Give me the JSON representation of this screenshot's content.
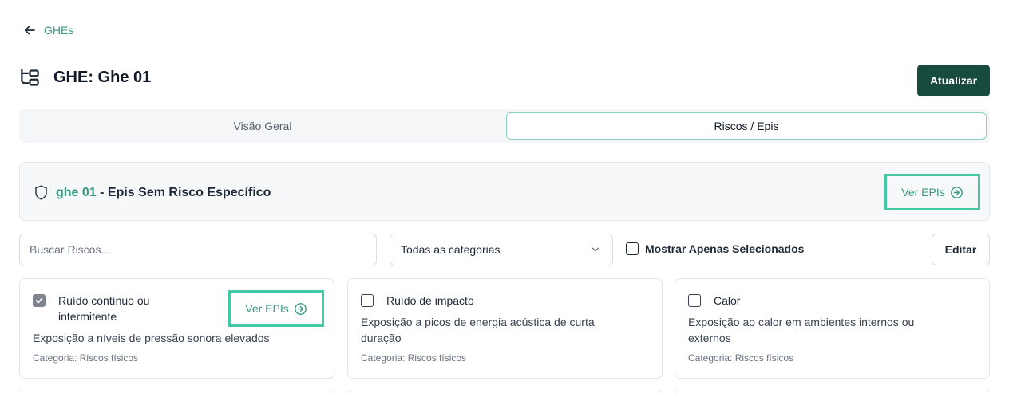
{
  "nav": {
    "back_label": "GHEs"
  },
  "header": {
    "title": "GHE: Ghe 01",
    "update_button": "Atualizar"
  },
  "tabs": [
    {
      "label": "Visão Geral",
      "active": false
    },
    {
      "label": "Riscos / Epis",
      "active": true
    }
  ],
  "panel": {
    "ghe_name": "ghe 01",
    "text": " - Epis Sem Risco Específico",
    "button_label": "Ver EPIs"
  },
  "filters": {
    "search_placeholder": "Buscar Riscos...",
    "category_selected": "Todas as categorias",
    "only_selected_label": "Mostrar Apenas Selecionados",
    "only_selected_checked": false,
    "edit_button": "Editar"
  },
  "risks": [
    {
      "name_line1": "Ruído contínuo ou",
      "name_line2": "intermitente",
      "checked": true,
      "description": "Exposição a níveis de pressão sonora elevados",
      "category": "Categoria: Riscos físicos",
      "button_label": "Ver EPIs"
    },
    {
      "name_line1": "Ruído de impacto",
      "checked": false,
      "description_line1": "Exposição a picos de energia acústica de curta",
      "description_line2": "duração",
      "category": "Categoria: Riscos físicos"
    },
    {
      "name_line1": "Calor",
      "checked": false,
      "description_line1": "Exposição ao calor em ambientes internos ou",
      "description_line2": "externos",
      "category": "Categoria: Riscos físicos"
    }
  ],
  "colors": {
    "accent": "#3a9a80",
    "primary_button": "#174b3d",
    "highlight_border": "#45c9a5"
  },
  "icons": {
    "back": "arrow-left-icon",
    "ghe": "hierarchy-icon",
    "panel": "shield-icon",
    "ver_epis": "circle-arrow-right-icon",
    "select": "chevron-down-icon",
    "checked": "check-icon"
  }
}
